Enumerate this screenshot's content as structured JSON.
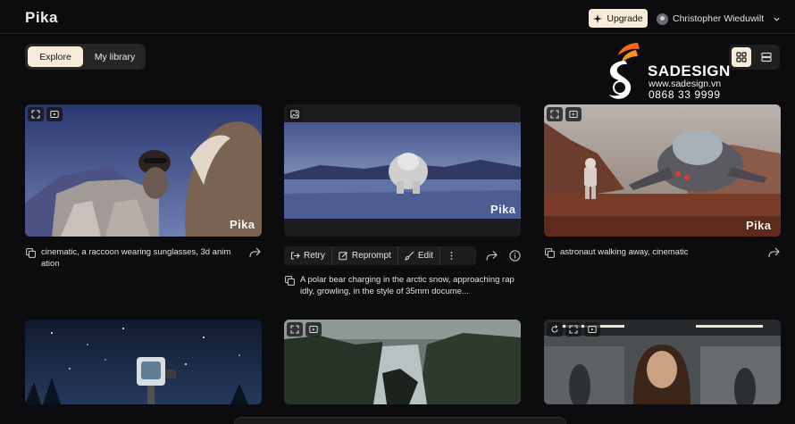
{
  "app": {
    "logo": "Pika"
  },
  "header": {
    "upgrade_label": "Upgrade",
    "user_name": "Christopher Wieduwilt"
  },
  "tabs": [
    {
      "label": "Explore",
      "active": true
    },
    {
      "label": "My library",
      "active": false
    }
  ],
  "view_toggle": {
    "selected": "grid"
  },
  "watermark": {
    "brand": "SADESIGN",
    "website": "www.sadesign.vn",
    "phone": "0868 33 9999"
  },
  "cards": [
    {
      "id": "raccoon",
      "caption_line1": "cinematic, a raccoon wearing sunglasses, 3d anim",
      "caption_line2": "ation",
      "watermark": "Pika"
    },
    {
      "id": "polar-bear",
      "caption_line1": "A polar bear charging in the arctic snow, approaching rap",
      "caption_line2": "idly, growling, in the style of 35mm docume...",
      "watermark": "Pika",
      "actions": [
        {
          "label": "Retry"
        },
        {
          "label": "Reprompt"
        },
        {
          "label": "Edit"
        }
      ]
    },
    {
      "id": "astronaut",
      "caption_line1": "astronaut walking away, cinematic",
      "caption_line2": "",
      "watermark": "Pika"
    },
    {
      "id": "robot-night"
    },
    {
      "id": "fjord"
    },
    {
      "id": "subway-girl"
    }
  ],
  "colors": {
    "background": "#0c0c0e",
    "accent_cream": "#f6ecd9",
    "watermark_orange": "#f26a1b"
  }
}
